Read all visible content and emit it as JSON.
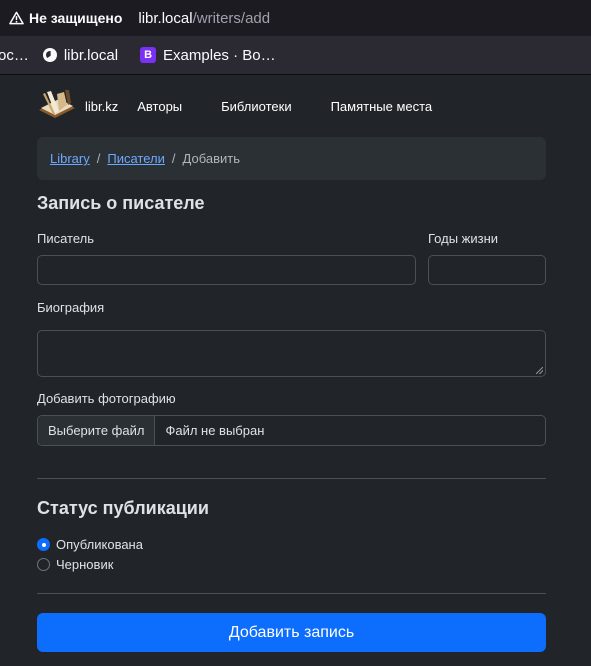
{
  "browser": {
    "security_label": "Не защищено",
    "url_host": "libr.local",
    "url_path": "/writers/add",
    "bookmarks": [
      {
        "label": "ос…",
        "icon": "truncated"
      },
      {
        "label": "libr.local",
        "icon": "globe-icon"
      },
      {
        "label": "Examples · Bo…",
        "icon": "bootstrap-icon",
        "icon_text": "B"
      }
    ]
  },
  "navbar": {
    "brand": "libr.kz",
    "links": [
      "Авторы",
      "Библиотеки",
      "Памятные места"
    ]
  },
  "breadcrumb": {
    "items": [
      "Library",
      "Писатели",
      "Добавить"
    ],
    "separator": "/"
  },
  "form": {
    "title": "Запись о писателе",
    "writer_label": "Писатель",
    "writer_value": "",
    "years_label": "Годы жизни",
    "years_value": "",
    "bio_label": "Биография",
    "bio_value": "",
    "photo_label": "Добавить фотографию",
    "photo_button": "Выберите файл",
    "photo_status": "Файл не выбран"
  },
  "status": {
    "title": "Статус публикации",
    "options": [
      {
        "label": "Опубликована",
        "checked": true
      },
      {
        "label": "Черновик",
        "checked": false
      }
    ]
  },
  "submit_label": "Добавить запись",
  "colors": {
    "background": "#212529",
    "primary": "#0d6efd",
    "link": "#6ea8fe"
  }
}
